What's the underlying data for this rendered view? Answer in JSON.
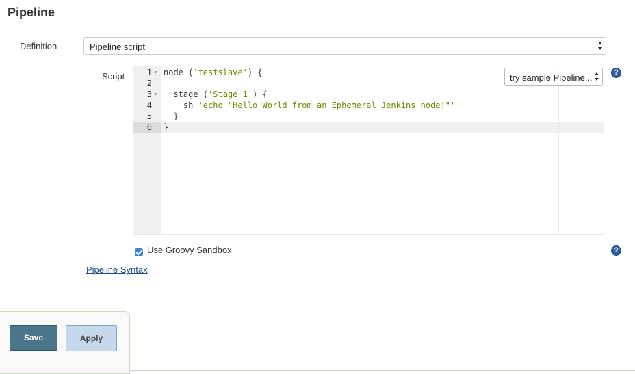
{
  "section": {
    "title": "Pipeline"
  },
  "definition": {
    "label": "Definition",
    "selected": "Pipeline script"
  },
  "script": {
    "label": "Script",
    "sample_select": "try sample Pipeline...",
    "lines": [
      {
        "num": "1",
        "code": "node ('testslave') {"
      },
      {
        "num": "2",
        "code": ""
      },
      {
        "num": "3",
        "code": "  stage ('Stage 1') {"
      },
      {
        "num": "4",
        "code": "    sh 'echo \"Hello World from an Ephemeral Jenkins node!\"'"
      },
      {
        "num": "5",
        "code": "  }"
      },
      {
        "num": "6",
        "code": "}"
      }
    ],
    "folds": [
      "▾",
      "▾"
    ]
  },
  "sandbox": {
    "label": "Use Groovy Sandbox",
    "checked": true
  },
  "links": {
    "pipeline_syntax": "Pipeline Syntax"
  },
  "buttons": {
    "save": "Save",
    "apply": "Apply"
  },
  "icons": {
    "help": "help-icon",
    "checkbox": "checkbox-checked-icon"
  },
  "colors": {
    "save_bg": "#4b758b",
    "apply_bg": "#c6d8ec",
    "help": "#2f5fa0",
    "string": "#6a8a00"
  }
}
